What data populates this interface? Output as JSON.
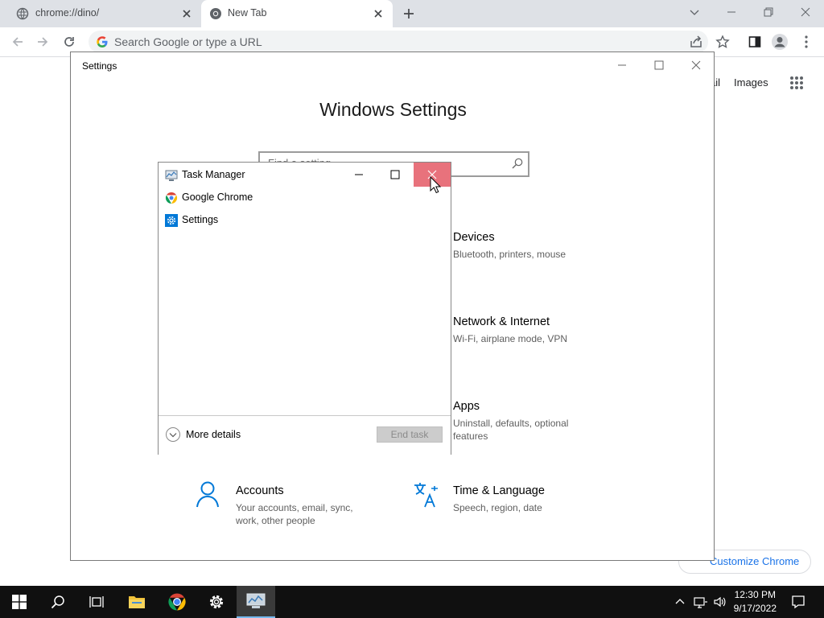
{
  "browser": {
    "tabs": [
      {
        "title": "chrome://dino/",
        "active": false
      },
      {
        "title": "New Tab",
        "active": true
      }
    ],
    "omnibox_placeholder": "Search Google or type a URL",
    "ntp": {
      "gmail_partial": "ail",
      "images": "Images",
      "customize": "Customize Chrome"
    }
  },
  "settings": {
    "window_title": "Settings",
    "heading": "Windows Settings",
    "search_placeholder": "Find a setting",
    "categories": [
      {
        "name": "Devices",
        "desc": "Bluetooth, printers, mouse",
        "icon": "keyboard-icon"
      },
      {
        "name": "Network & Internet",
        "desc": "Wi-Fi, airplane mode, VPN",
        "icon": "globe-icon"
      },
      {
        "name": "Apps",
        "desc": "Uninstall, defaults, optional features",
        "icon": "apps-icon"
      },
      {
        "name": "Accounts",
        "desc": "Your accounts, email, sync, work, other people",
        "icon": "person-icon"
      },
      {
        "name": "Time & Language",
        "desc": "Speech, region, date",
        "icon": "time-language-icon"
      }
    ]
  },
  "task_manager": {
    "title": "Task Manager",
    "processes": [
      {
        "name": "Google Chrome",
        "icon": "chrome-icon"
      },
      {
        "name": "Settings",
        "icon": "gear-icon"
      }
    ],
    "more_details": "More details",
    "end_task": "End task"
  },
  "taskbar": {
    "time": "12:30 PM",
    "date": "9/17/2022"
  },
  "colors": {
    "accent": "#0078d7",
    "close_hover": "#e8727c",
    "taskbar": "#101010",
    "link": "#1a73e8"
  }
}
